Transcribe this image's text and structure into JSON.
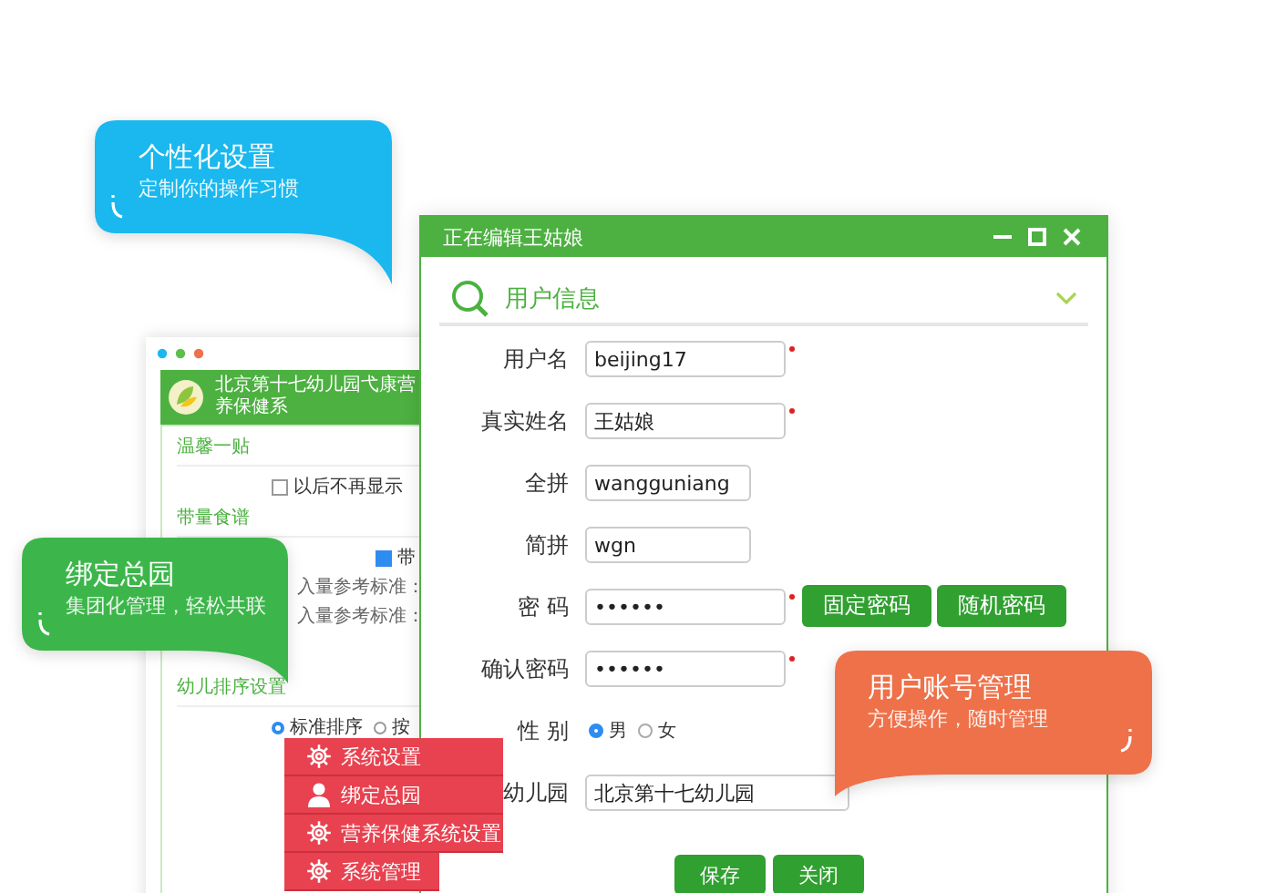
{
  "back_window": {
    "title": "北京第十七幼儿园弋康营养保健系",
    "notice": {
      "heading": "温馨一贴",
      "checkbox": {
        "label": "以后不再显示",
        "checked": false
      }
    },
    "recipe": {
      "heading": "带量食谱",
      "checkbox": {
        "label": "带",
        "checked": true
      },
      "lines": [
        "入量参考标准：",
        "入量参考标准："
      ]
    },
    "sorting": {
      "heading": "幼儿排序设置",
      "options": [
        {
          "label": "标准排序",
          "selected": true
        },
        {
          "label": "按",
          "selected": false
        }
      ]
    }
  },
  "editor": {
    "title": "正在编辑王姑娘",
    "section": "用户信息",
    "fields": [
      {
        "kind": "text",
        "label": "用户名",
        "value": "beijing17",
        "required": true
      },
      {
        "kind": "text",
        "label": "真实姓名",
        "value": "王姑娘",
        "required": true
      },
      {
        "kind": "text",
        "label": "全拼",
        "value": "wangguniang",
        "required": false
      },
      {
        "kind": "text",
        "label": "简拼",
        "value": "wgn",
        "required": false
      },
      {
        "kind": "text",
        "label": "密 码",
        "value": "••••••",
        "required": true,
        "buttons": [
          "固定密码",
          "随机密码"
        ]
      },
      {
        "kind": "text",
        "label": "确认密码",
        "value": "••••••",
        "required": true
      },
      {
        "kind": "radio",
        "label": "性 别",
        "options": [
          {
            "label": "男",
            "selected": true
          },
          {
            "label": "女",
            "selected": false
          }
        ]
      },
      {
        "kind": "text",
        "label": "幼儿园",
        "value": "北京第十七幼儿园",
        "required": false
      }
    ],
    "buttons": [
      "保存",
      "关闭"
    ]
  },
  "menu": [
    {
      "kind": "gear",
      "label": "系统设置"
    },
    {
      "kind": "user",
      "label": "绑定总园"
    },
    {
      "kind": "gear",
      "label": "营养保健系统设置"
    },
    {
      "kind": "gear",
      "label": "系统管理"
    }
  ],
  "callouts": [
    {
      "kind": "right",
      "title": "个性化设置",
      "subtitle": "定制你的操作习惯",
      "color": "#1ab8ee"
    },
    {
      "kind": "right",
      "title": "绑定总园",
      "subtitle": "集团化管理，轻松共联",
      "color": "#3cb64a"
    },
    {
      "kind": "left",
      "title": "用户账号管理",
      "subtitle": "方便操作，随时管理",
      "color": "#ee714a"
    }
  ]
}
